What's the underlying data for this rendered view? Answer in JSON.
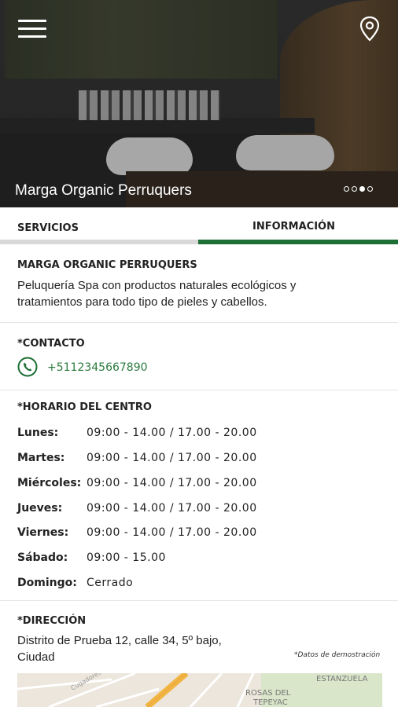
{
  "header": {
    "title": "Marga Organic Perruquers",
    "menu_icon": "hamburger-menu-icon",
    "location_icon": "map-pin-icon",
    "carousel_dots": [
      false,
      false,
      true,
      false
    ]
  },
  "tabs": {
    "items": [
      {
        "label": "SERVICIOS",
        "active": false
      },
      {
        "label": "INFORMACIÓN",
        "active": true
      }
    ],
    "accent_color": "#1e6f35",
    "inactive_color": "#d9d9d9"
  },
  "about": {
    "title": "MARGA ORGANIC PERRUQUERS",
    "line1": "Peluquería Spa con productos naturales ecológicos y",
    "line2": "tratamientos para todo tipo de pieles y cabellos."
  },
  "contact": {
    "title": "*CONTACTO",
    "phone": "+5112345667890",
    "phone_icon": "phone-icon",
    "phone_color": "#2a7a3e"
  },
  "schedule": {
    "title": "*HORARIO DEL CENTRO",
    "days": [
      {
        "day": "Lunes:",
        "hours": "09:00 - 14.00  /  17.00 - 20.00"
      },
      {
        "day": "Martes:",
        "hours": "09:00 - 14.00  /  17.00 - 20.00"
      },
      {
        "day": "Miércoles:",
        "hours": "09:00 - 14.00  /  17.00 - 20.00"
      },
      {
        "day": "Jueves:",
        "hours": "09:00 - 14.00  /  17.00 - 20.00"
      },
      {
        "day": "Viernes:",
        "hours": "09:00 - 14.00  /  17.00 - 20.00"
      },
      {
        "day": "Sábado:",
        "hours": "09:00 - 15.00"
      },
      {
        "day": "Domingo:",
        "hours": "Cerrado"
      }
    ]
  },
  "address": {
    "title": "*DIRECCIÓN",
    "line1": "Distrito de Prueba 12, calle 34, 5º bajo,",
    "line2": "Ciudad",
    "demo_note": "*Datos de demostración"
  },
  "map": {
    "labels": [
      "ESTANZUELA",
      "ROSAS DEL",
      "TEPEYAC",
      "Cugadores"
    ]
  }
}
